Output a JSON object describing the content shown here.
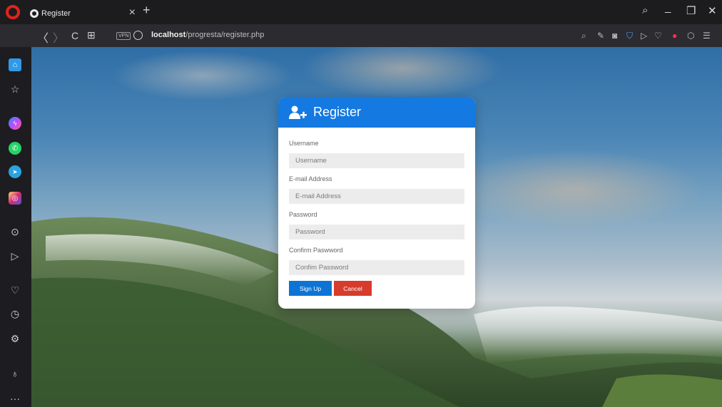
{
  "browser": {
    "tab_title": "Register",
    "tab_close": "×",
    "new_tab": "+",
    "vpn_badge": "VPN",
    "url_host": "localhost",
    "url_path": "/progresta/register.php",
    "window_controls": {
      "search": "⌕",
      "minimize": "_",
      "restore": "❐",
      "close": "✕"
    },
    "nav": {
      "back": "〈",
      "forward": "〉",
      "reload": "C",
      "grid": "⊞"
    }
  },
  "sidebar": {
    "icons": [
      "home-icon",
      "star-icon",
      "messenger-icon",
      "whatsapp-icon",
      "telegram-icon",
      "instagram-icon",
      "player-icon",
      "send-icon",
      "heart-icon",
      "history-icon",
      "settings-icon",
      "lightbulb-icon",
      "more-icon"
    ],
    "more": "···"
  },
  "form": {
    "title": "Register",
    "username_label": "Username",
    "username_placeholder": "Username",
    "email_label": "E-mail Address",
    "email_placeholder": "E-mail Address",
    "password_label": "Password",
    "password_placeholder": "Password",
    "confirm_label": "Confirm Paswword",
    "confirm_placeholder": "Confim Password",
    "signup_label": "Sign Up",
    "cancel_label": "Cancel"
  },
  "colors": {
    "header_blue": "#1479e0",
    "signup_blue": "#0d74d6",
    "cancel_red": "#d63b2b",
    "opera_red": "#e2231a"
  }
}
